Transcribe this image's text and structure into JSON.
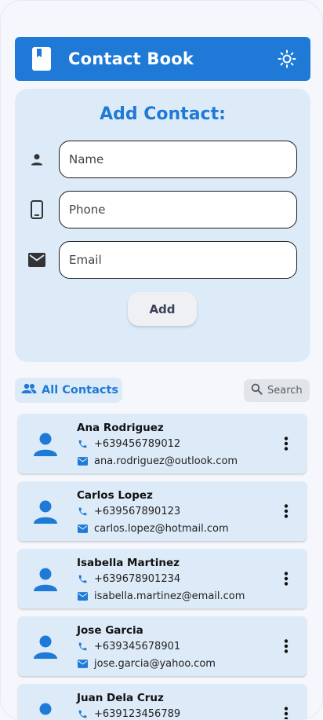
{
  "app": {
    "title": "Contact Book"
  },
  "form": {
    "title": "Add Contact:",
    "name_placeholder": "Name",
    "phone_placeholder": "Phone",
    "email_placeholder": "Email",
    "add_label": "Add"
  },
  "list": {
    "all_contacts_label": "All Contacts",
    "search_label": "Search"
  },
  "contacts": [
    {
      "name": "Ana Rodriguez",
      "phone": "+639456789012",
      "email": "ana.rodriguez@outlook.com"
    },
    {
      "name": "Carlos Lopez",
      "phone": "+639567890123",
      "email": "carlos.lopez@hotmail.com"
    },
    {
      "name": "Isabella Martinez",
      "phone": "+639678901234",
      "email": "isabella.martinez@email.com"
    },
    {
      "name": "Jose Garcia",
      "phone": "+639345678901",
      "email": "jose.garcia@yahoo.com"
    },
    {
      "name": "Juan Dela Cruz",
      "phone": "+639123456789",
      "email": ""
    }
  ],
  "colors": {
    "primary": "#1f7ad7",
    "card": "#ddebf8",
    "background": "#f5f7fd"
  },
  "icons": {
    "appbar": [
      "book-icon",
      "theme-toggle-icon"
    ],
    "form": [
      "person-icon",
      "phone-device-icon",
      "mail-icon"
    ],
    "list": [
      "people-icon",
      "search-icon",
      "avatar-icon",
      "phone-icon",
      "mail-icon",
      "more-vert-icon"
    ]
  }
}
